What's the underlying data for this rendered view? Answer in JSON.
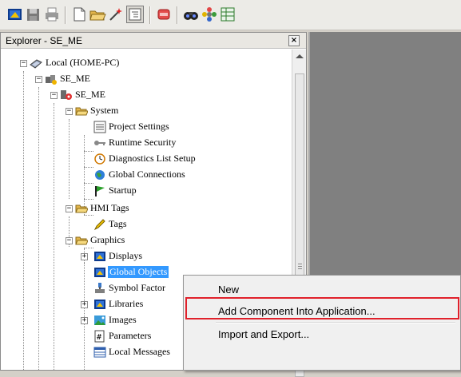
{
  "toolbar": {
    "icons": [
      "color-palette-icon",
      "save-icon",
      "print-icon",
      "new-document-icon",
      "open-folder-icon",
      "wand-icon",
      "explorer-toggle-icon",
      "stop-icon",
      "binoculars-icon",
      "settings-icon",
      "grid-icon"
    ]
  },
  "explorer": {
    "title": "Explorer - SE_ME",
    "close_label": "×"
  },
  "tree": {
    "local": "Local (HOME-PC)",
    "app": "SE_ME",
    "area": "SE_ME",
    "system": "System",
    "project_settings": "Project Settings",
    "runtime_security": "Runtime Security",
    "diagnostics": "Diagnostics List Setup",
    "global_connections": "Global Connections",
    "startup": "Startup",
    "hmi_tags": "HMI Tags",
    "tags": "Tags",
    "graphics": "Graphics",
    "displays": "Displays",
    "global_objects": "Global Objects",
    "symbol_factory": "Symbol Factor",
    "libraries": "Libraries",
    "images": "Images",
    "parameters": "Parameters",
    "local_messages": "Local Messages"
  },
  "context_menu": {
    "items": [
      "New",
      "Add Component Into Application...",
      "Import and Export..."
    ]
  },
  "colors": {
    "selection": "#3399ff",
    "highlight_box": "#e0212b",
    "workspace": "#808080"
  }
}
